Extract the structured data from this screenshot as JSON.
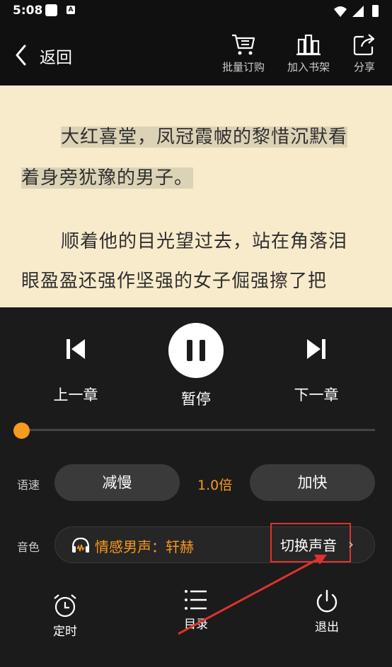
{
  "status_bar": {
    "time": "5:08"
  },
  "top_bar": {
    "back_label": "返回",
    "batch_order_label": "批量订购",
    "add_shelf_label": "加入书架",
    "share_label": "分享"
  },
  "reader": {
    "line1_indent": "大红喜堂，凤冠霞帔的黎惜沉默看",
    "line1_rest": "着身旁犹豫的男子。",
    "line2_indent": "顺着他的目光望过去，站在角落泪",
    "line2_rest": "眼盈盈还强作坚强的女子倔强擦了把"
  },
  "player": {
    "prev_label": "上一章",
    "pause_label": "暂停",
    "next_label": "下一章",
    "progress": 0.0
  },
  "speed": {
    "label": "语速",
    "slower_label": "减慢",
    "value": "1.0倍",
    "faster_label": "加快"
  },
  "voice": {
    "label": "音色",
    "name": "情感男声：轩赫",
    "switch_label": "切换声音",
    "chevron": "›"
  },
  "bottom": {
    "timer_label": "定时",
    "toc_label": "目录",
    "exit_label": "退出"
  },
  "colors": {
    "accent": "#f79a1d",
    "highlight_box": "#e0322c",
    "reader_bg": "#f8ebcb"
  }
}
